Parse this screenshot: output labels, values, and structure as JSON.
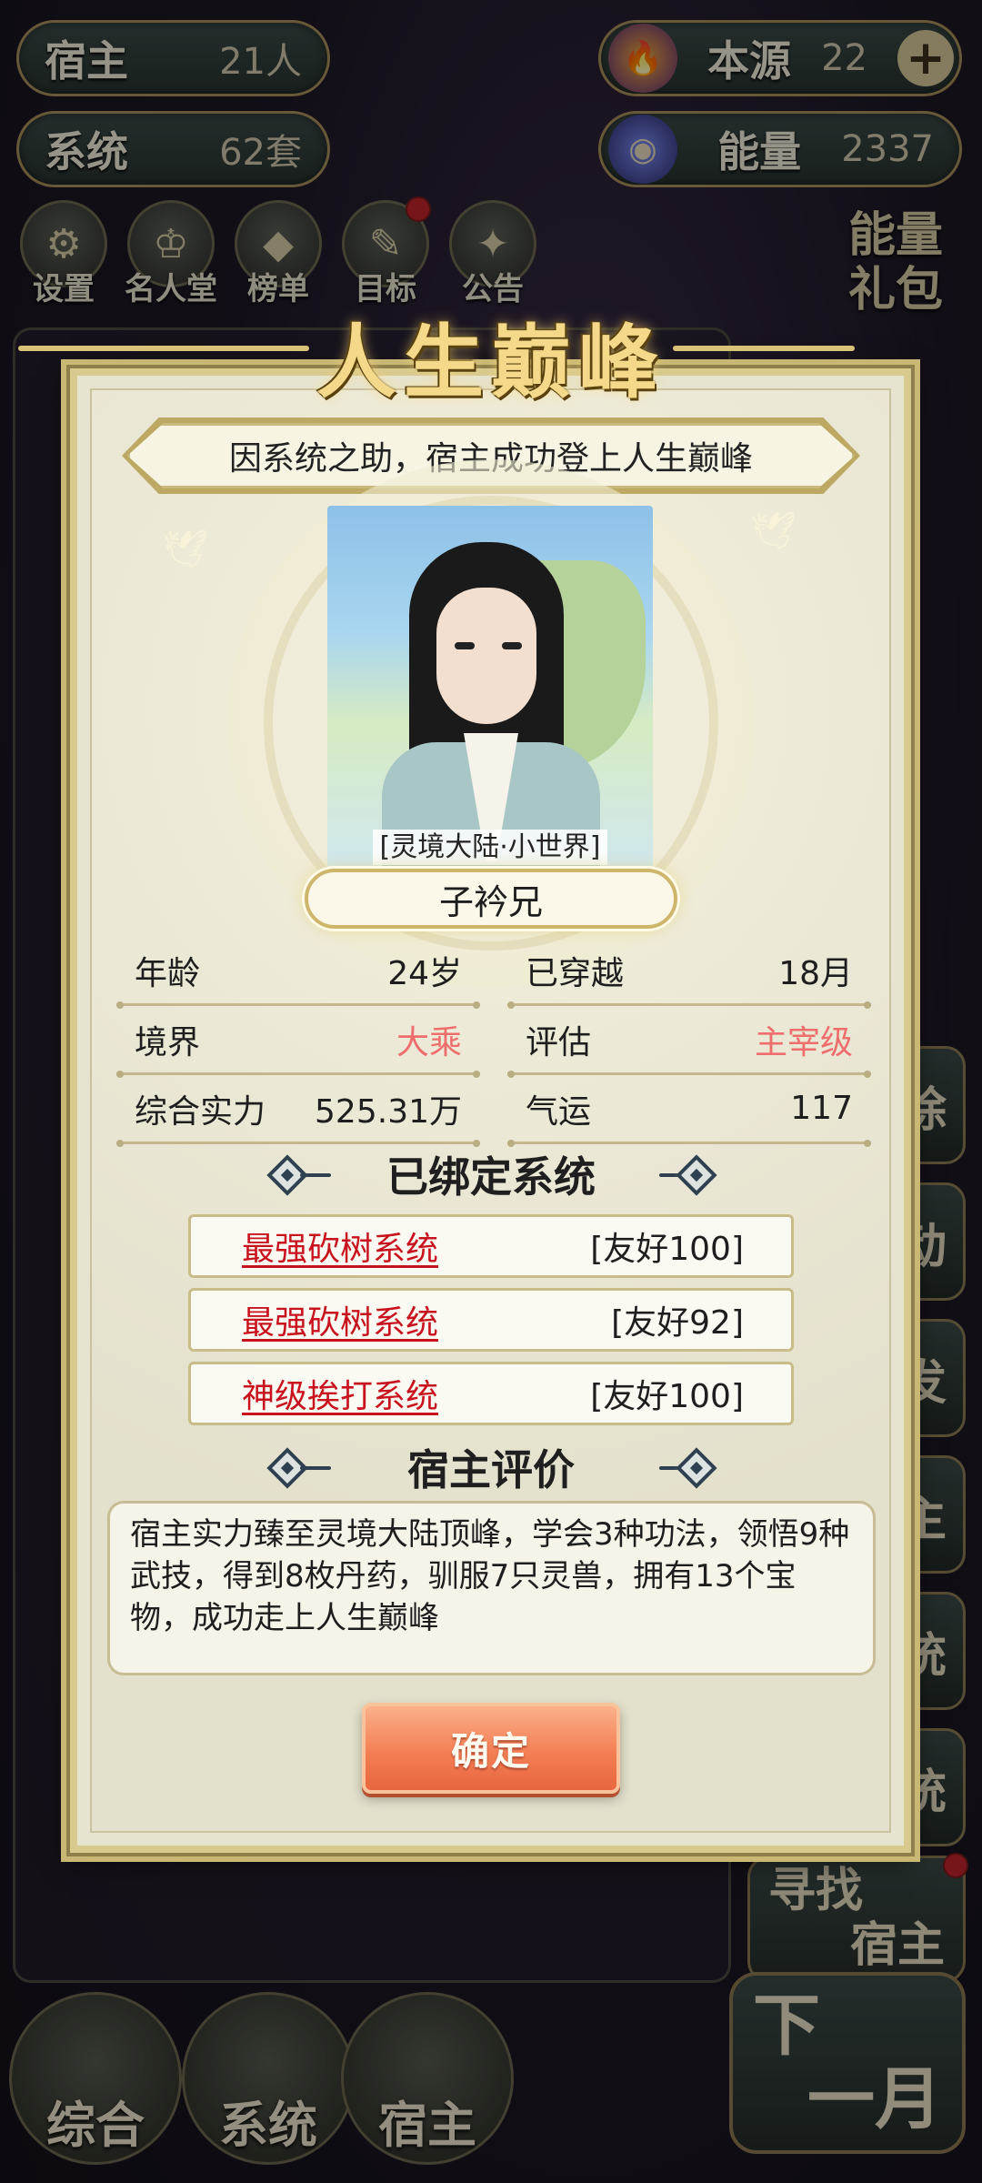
{
  "hud": {
    "hosts_label": "宿主",
    "hosts_value": "21人",
    "systems_label": "系统",
    "systems_value": "62套",
    "source_label": "本源",
    "source_value": "22",
    "energy_label": "能量",
    "energy_value": "2337"
  },
  "menu": [
    {
      "label": "设置",
      "icon": "gear-icon"
    },
    {
      "label": "名人堂",
      "icon": "hall-of-fame-icon"
    },
    {
      "label": "榜单",
      "icon": "ranking-icon"
    },
    {
      "label": "目标",
      "icon": "goal-icon"
    },
    {
      "label": "公告",
      "icon": "notice-icon"
    }
  ],
  "energy_pack": {
    "line1": "能量",
    "line2": "礼包"
  },
  "side_buttons": [
    "除",
    "动",
    "发",
    "主",
    "统",
    "统"
  ],
  "find_host": {
    "line1": "寻找",
    "line2": "宿主"
  },
  "bottom_nav": [
    "综合",
    "系统",
    "宿主"
  ],
  "next_month": {
    "line1": "下",
    "line2": "一月"
  },
  "modal": {
    "title": "人生巅峰",
    "headline": "因系统之助，宿主成功登上人生巅峰",
    "world": "[灵境大陆·小世界]",
    "name": "子衿兄",
    "stats": {
      "age_label": "年龄",
      "age_value": "24岁",
      "traveled_label": "已穿越",
      "traveled_value": "18月",
      "realm_label": "境界",
      "realm_value": "大乘",
      "rating_label": "评估",
      "rating_value": "主宰级",
      "power_label": "综合实力",
      "power_value": "525.31万",
      "luck_label": "气运",
      "luck_value": "117"
    },
    "bound_title": "已绑定系统",
    "systems": [
      {
        "name": "最强砍树系统",
        "favor": "[友好100]"
      },
      {
        "name": "最强砍树系统",
        "favor": "[友好92]"
      },
      {
        "name": "神级挨打系统",
        "favor": "[友好100]"
      }
    ],
    "eval_title": "宿主评价",
    "evaluation": "宿主实力臻至灵境大陆顶峰，学会3种功法，领悟9种武技，得到8枚丹药，驯服7只灵兽，拥有13个宝物，成功走上人生巅峰",
    "confirm": "确定"
  },
  "colors": {
    "accent_red": "#c8121e",
    "value_pink": "#ee6e6e",
    "button_orange": "#f47f55"
  }
}
